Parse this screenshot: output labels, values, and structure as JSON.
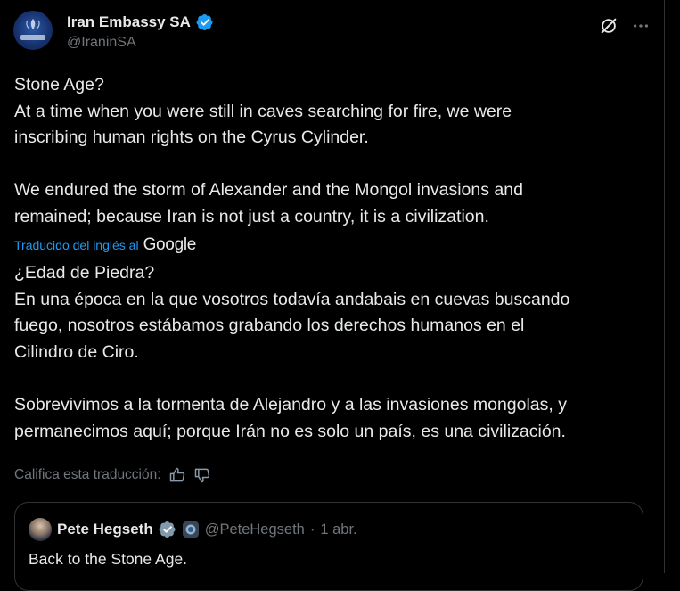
{
  "author": {
    "display_name": "Iran Embassy SA",
    "handle": "@IraninSA"
  },
  "post": {
    "original_text": "Stone Age?\nAt a time when you were still in caves searching for fire, we were\ninscribing human rights on the Cyrus Cylinder.\n\nWe endured the storm of Alexander and the Mongol invasions and\nremained; because Iran is not just a country, it is a civilization.",
    "translated_by_label": "Traducido del inglés al",
    "translator_brand": "Google",
    "translated_text": "¿Edad de Piedra?\nEn una época en la que vosotros todavía andabais en cuevas buscando\nfuego, nosotros estábamos grabando los derechos humanos en el\nCilindro de Ciro.\n\nSobrevivimos a la tormenta de Alejandro y a las invasiones mongolas, y\npermanecimos aquí; porque Irán no es solo un país, es una civilización.",
    "rate_label": "Califica esta traducción:"
  },
  "quote": {
    "display_name": "Pete Hegseth",
    "handle": "@PeteHegseth",
    "separator": "·",
    "date": "1 abr.",
    "text": "Back to the Stone Age."
  },
  "colors": {
    "background": "#000000",
    "text_primary": "#e7e9ea",
    "text_secondary": "#71767b",
    "accent": "#1d9bf0",
    "border": "#2f3336"
  }
}
